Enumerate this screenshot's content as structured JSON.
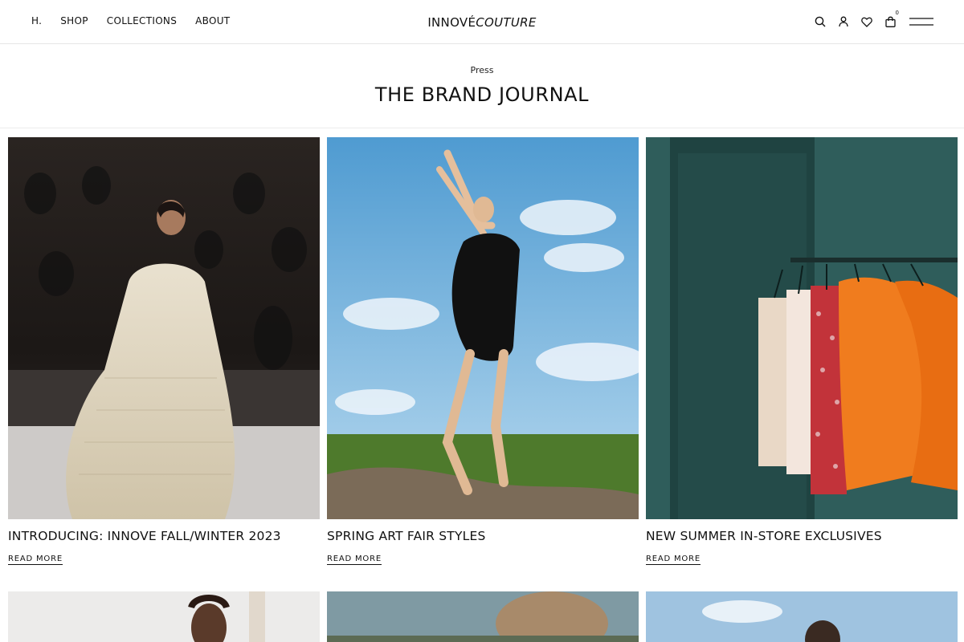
{
  "header": {
    "nav": [
      {
        "label": "H."
      },
      {
        "label": "SHOP"
      },
      {
        "label": "COLLECTIONS"
      },
      {
        "label": "ABOUT"
      }
    ],
    "logo_a": "INNOVÉ",
    "logo_b": "COUTURE",
    "cart_count": "0",
    "icons": [
      "search-icon",
      "user-icon",
      "heart-icon",
      "bag-icon",
      "menu-icon"
    ]
  },
  "page": {
    "eyebrow": "Press",
    "title": "THE BRAND JOURNAL"
  },
  "articles": [
    {
      "title": "INTRODUCING: INNOVE FALL/WINTER 2023",
      "link": "READ MORE"
    },
    {
      "title": "SPRING ART FAIR STYLES",
      "link": "READ MORE"
    },
    {
      "title": "NEW SUMMER IN-STORE EXCLUSIVES",
      "link": "READ MORE"
    }
  ]
}
